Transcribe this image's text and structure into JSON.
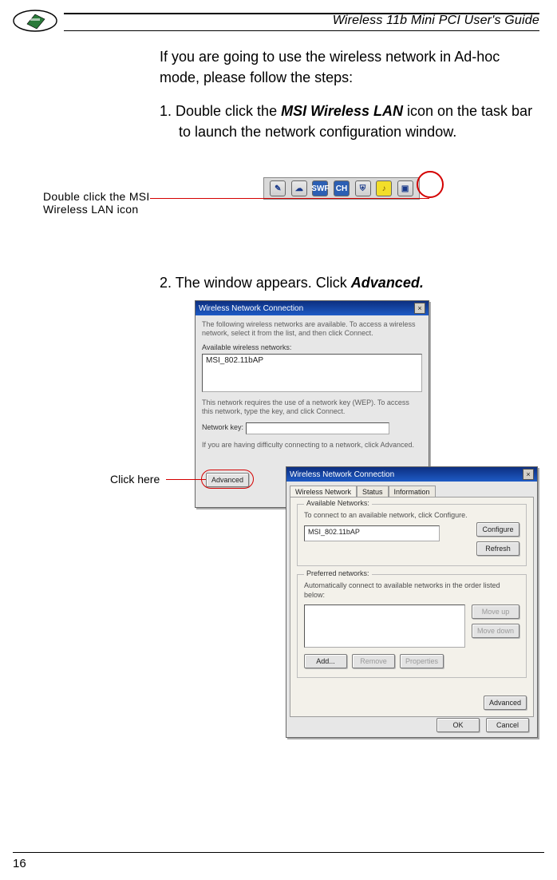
{
  "header": {
    "title": "Wireless 11b Mini PCI  User's Guide"
  },
  "body": {
    "para1": "If you are going to use the wireless network in Ad-hoc mode, please follow the steps:",
    "step1_pre": "1. Double click the ",
    "step1_bold": "MSI Wireless LAN",
    "step1_post": " icon on the task bar to launch the network configuration window.",
    "step2_pre": "2. The window appears. Click ",
    "step2_bold": "Advanced."
  },
  "callouts": {
    "taskbar": "Double click the MSI Wireless LAN icon",
    "advanced": "Click here"
  },
  "taskbar": {
    "icons": [
      {
        "name": "note-icon",
        "glyph": "✎"
      },
      {
        "name": "globe-icon",
        "glyph": "☁"
      },
      {
        "name": "swf-icon",
        "glyph": "SWF"
      },
      {
        "name": "ch-icon",
        "glyph": "CH"
      },
      {
        "name": "shield-icon",
        "glyph": "⛨"
      },
      {
        "name": "speaker-icon",
        "glyph": "♪"
      },
      {
        "name": "msi-wireless-lan-icon",
        "glyph": "▣"
      }
    ]
  },
  "dialog1": {
    "title": "Wireless Network Connection",
    "desc": "The following wireless networks are available. To access a wireless network, select it from the list, and then click Connect.",
    "available_label": "Available wireless networks:",
    "available_item": "MSI_802.11bAP",
    "wep_text": "This network requires the use of a network key (WEP). To access this network, type the key, and click Connect.",
    "key_label": "Network key:",
    "difficulty_text": "If you are having difficulty connecting to a network, click Advanced.",
    "advanced_btn": "Advanced"
  },
  "dialog2": {
    "title": "Wireless Network Connection",
    "tabs": {
      "t1": "Wireless Network",
      "t2": "Status",
      "t3": "Information"
    },
    "group_available": {
      "legend": "Available Networks:",
      "desc": "To connect to an available network, click Configure.",
      "item": "MSI_802.11bAP",
      "configure": "Configure",
      "refresh": "Refresh"
    },
    "group_preferred": {
      "legend": "Preferred networks:",
      "desc": "Automatically connect to available networks in the order listed below:",
      "move_up": "Move up",
      "move_down": "Move down",
      "add": "Add...",
      "remove": "Remove",
      "properties": "Properties"
    },
    "advanced": "Advanced",
    "ok": "OK",
    "cancel": "Cancel"
  },
  "footer": {
    "page": "16"
  }
}
